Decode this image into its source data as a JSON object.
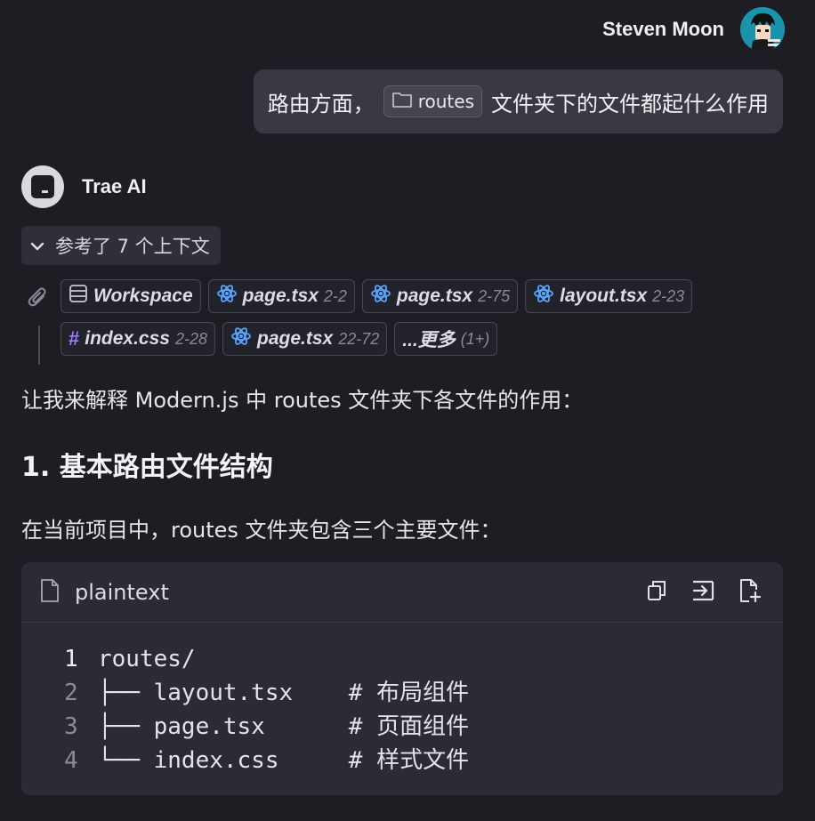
{
  "user": {
    "name": "Steven Moon"
  },
  "user_message": {
    "text_before": "路由方面，",
    "folder_chip": "routes",
    "text_after": "文件夹下的文件都起什么作用"
  },
  "assistant": {
    "name": "Trae AI"
  },
  "context": {
    "toggle_label": "参考了 7 个上下文",
    "chips": [
      {
        "name": "Workspace",
        "range": ""
      },
      {
        "name": "page.tsx",
        "range": "2-2"
      },
      {
        "name": "page.tsx",
        "range": "2-75"
      },
      {
        "name": "layout.tsx",
        "range": "2-23"
      },
      {
        "name": "index.css",
        "range": "2-28"
      },
      {
        "name": "page.tsx",
        "range": "22-72"
      },
      {
        "name": "...更多",
        "range": "(1+)"
      }
    ]
  },
  "answer": {
    "intro": "让我来解释 Modern.js 中 routes 文件夹下各文件的作用：",
    "heading": "1. 基本路由文件结构",
    "para": "在当前项目中，routes 文件夹包含三个主要文件：",
    "code": {
      "language": "plaintext",
      "lines": [
        {
          "n": "1",
          "text": "routes/"
        },
        {
          "n": "2",
          "text": "├── layout.tsx    # 布局组件"
        },
        {
          "n": "3",
          "text": "├── page.tsx      # 页面组件"
        },
        {
          "n": "4",
          "text": "└── index.css     # 样式文件"
        }
      ]
    }
  },
  "colors": {
    "background": "#1d1d23",
    "bubble": "#393944",
    "react_icon": "#58a6ff",
    "css_icon": "#9b7bff"
  }
}
